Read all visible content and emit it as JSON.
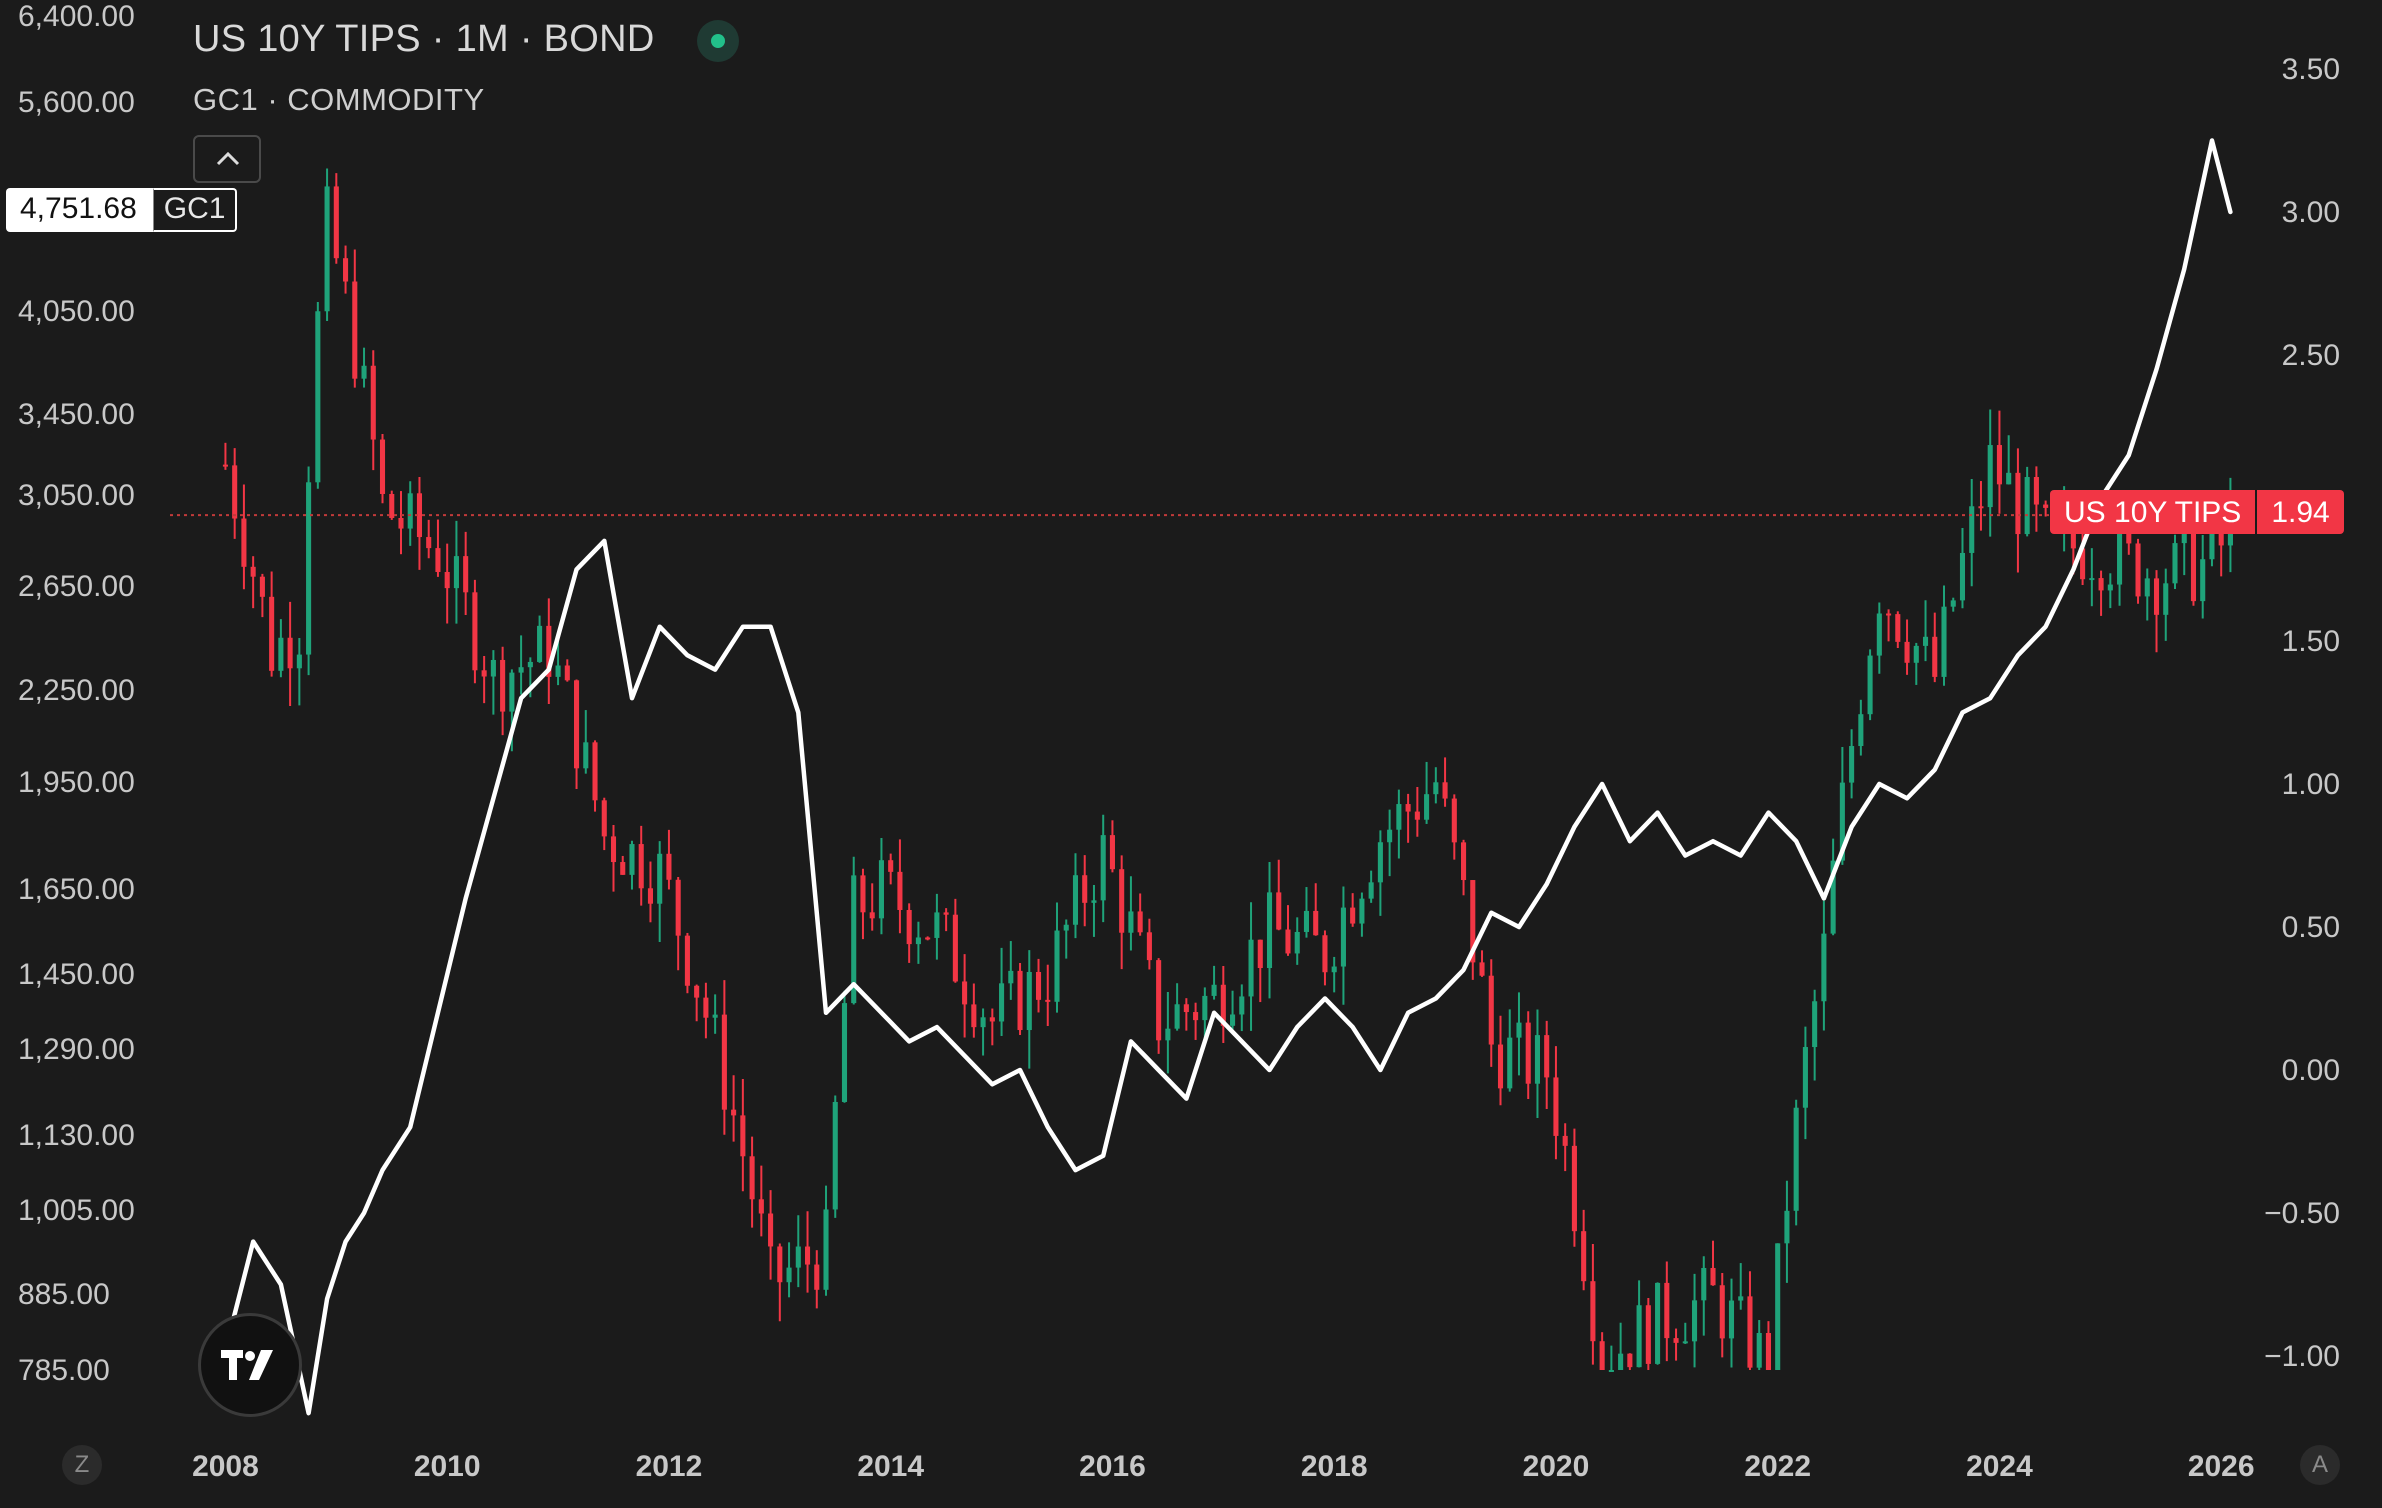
{
  "header": {
    "title": "US 10Y TIPS · 1M · BOND",
    "subtitle": "GC1 · COMMODITY"
  },
  "price_tags": {
    "gc1_value": "4,751.68",
    "gc1_name": "GC1",
    "tips_name": "US 10Y TIPS",
    "tips_value": "1.94"
  },
  "corner_buttons": {
    "left": "Z",
    "right": "A"
  },
  "colors": {
    "background": "#1b1b1b",
    "up_candle": "#1fa37a",
    "down_candle": "#f23645",
    "line": "#ffffff",
    "axis_text": "#c8c8c8"
  },
  "chart_data": {
    "type": "line",
    "left_axis": {
      "series": "GC1",
      "ticks": [
        6400,
        5600,
        4050,
        3450,
        3050,
        2650,
        2250,
        1950,
        1650,
        1450,
        1290,
        1130,
        1005,
        885,
        785
      ],
      "tick_labels": [
        "6,400.00",
        "5,600.00",
        "4,050.00",
        "3,450.00",
        "3,050.00",
        "2,650.00",
        "2,250.00",
        "1,950.00",
        "1,650.00",
        "1,450.00",
        "1,290.00",
        "1,130.00",
        "1,005.00",
        "885.00",
        "785.00"
      ],
      "scale": "nonlinear"
    },
    "right_axis": {
      "series": "US 10Y TIPS",
      "ticks": [
        3.5,
        3.0,
        2.5,
        2.0,
        1.5,
        1.0,
        0.5,
        0.0,
        -0.5,
        -1.0
      ],
      "tick_labels": [
        "3.50",
        "3.00",
        "2.50",
        "",
        "1.50",
        "1.00",
        "0.50",
        "0.00",
        "−0.50",
        "−1.00"
      ],
      "range": [
        -1.25,
        3.5
      ]
    },
    "x_axis": {
      "ticks": [
        "2008",
        "2010",
        "2012",
        "2014",
        "2016",
        "2018",
        "2020",
        "2022",
        "2024",
        "2026"
      ],
      "range": [
        "2007-07",
        "2026-04"
      ]
    },
    "last_value_line": {
      "series": "US 10Y TIPS",
      "value": 1.94,
      "style": "dotted"
    },
    "series": [
      {
        "name": "US 10Y TIPS",
        "type": "line",
        "axis": "right",
        "points": [
          [
            "2008-01",
            -0.98
          ],
          [
            "2008-04",
            -0.6
          ],
          [
            "2008-07",
            -0.75
          ],
          [
            "2008-10",
            -1.2
          ],
          [
            "2008-12",
            -0.8
          ],
          [
            "2009-02",
            -0.6
          ],
          [
            "2009-04",
            -0.5
          ],
          [
            "2009-06",
            -0.35
          ],
          [
            "2009-09",
            -0.2
          ],
          [
            "2009-12",
            0.2
          ],
          [
            "2010-03",
            0.6
          ],
          [
            "2010-06",
            0.95
          ],
          [
            "2010-09",
            1.3
          ],
          [
            "2010-12",
            1.4
          ],
          [
            "2011-03",
            1.75
          ],
          [
            "2011-06",
            1.85
          ],
          [
            "2011-09",
            1.3
          ],
          [
            "2011-12",
            1.55
          ],
          [
            "2012-03",
            1.45
          ],
          [
            "2012-06",
            1.4
          ],
          [
            "2012-09",
            1.55
          ],
          [
            "2012-12",
            1.55
          ],
          [
            "2013-03",
            1.25
          ],
          [
            "2013-06",
            0.2
          ],
          [
            "2013-09",
            0.3
          ],
          [
            "2013-12",
            0.2
          ],
          [
            "2014-03",
            0.1
          ],
          [
            "2014-06",
            0.15
          ],
          [
            "2014-09",
            0.05
          ],
          [
            "2014-12",
            -0.05
          ],
          [
            "2015-03",
            0.0
          ],
          [
            "2015-06",
            -0.2
          ],
          [
            "2015-09",
            -0.35
          ],
          [
            "2015-12",
            -0.3
          ],
          [
            "2016-03",
            0.1
          ],
          [
            "2016-06",
            0.0
          ],
          [
            "2016-09",
            -0.1
          ],
          [
            "2016-12",
            0.2
          ],
          [
            "2017-03",
            0.1
          ],
          [
            "2017-06",
            0.0
          ],
          [
            "2017-09",
            0.15
          ],
          [
            "2017-12",
            0.25
          ],
          [
            "2018-03",
            0.15
          ],
          [
            "2018-06",
            0.0
          ],
          [
            "2018-09",
            0.2
          ],
          [
            "2018-12",
            0.25
          ],
          [
            "2019-03",
            0.35
          ],
          [
            "2019-06",
            0.55
          ],
          [
            "2019-09",
            0.5
          ],
          [
            "2019-12",
            0.65
          ],
          [
            "2020-03",
            0.85
          ],
          [
            "2020-06",
            1.0
          ],
          [
            "2020-09",
            0.8
          ],
          [
            "2020-12",
            0.9
          ],
          [
            "2021-03",
            0.75
          ],
          [
            "2021-06",
            0.8
          ],
          [
            "2021-09",
            0.75
          ],
          [
            "2021-12",
            0.9
          ],
          [
            "2022-03",
            0.8
          ],
          [
            "2022-06",
            0.6
          ],
          [
            "2022-09",
            0.85
          ],
          [
            "2022-12",
            1.0
          ],
          [
            "2023-03",
            0.95
          ],
          [
            "2023-06",
            1.05
          ],
          [
            "2023-09",
            1.25
          ],
          [
            "2023-12",
            1.3
          ],
          [
            "2024-03",
            1.45
          ],
          [
            "2024-06",
            1.55
          ],
          [
            "2024-09",
            1.75
          ],
          [
            "2024-12",
            2.0
          ],
          [
            "2025-03",
            2.15
          ],
          [
            "2025-06",
            2.45
          ],
          [
            "2025-09",
            2.8
          ],
          [
            "2025-12",
            3.25
          ],
          [
            "2026-02",
            3.0
          ]
        ]
      },
      {
        "name": "GC1",
        "type": "candlestick",
        "axis": "left",
        "monthly_close": [
          [
            "2008-01",
            3200
          ],
          [
            "2008-06",
            2400
          ],
          [
            "2008-09",
            2500
          ],
          [
            "2008-12",
            4700
          ],
          [
            "2009-06",
            3000
          ],
          [
            "2009-12",
            2800
          ],
          [
            "2010-06",
            2300
          ],
          [
            "2010-12",
            2400
          ],
          [
            "2011-06",
            1800
          ],
          [
            "2011-12",
            1700
          ],
          [
            "2012-06",
            1300
          ],
          [
            "2012-12",
            900
          ],
          [
            "2013-06",
            950
          ],
          [
            "2013-09",
            1600
          ],
          [
            "2013-12",
            1650
          ],
          [
            "2014-06",
            1550
          ],
          [
            "2014-12",
            1350
          ],
          [
            "2015-06",
            1450
          ],
          [
            "2015-12",
            1750
          ],
          [
            "2016-06",
            1350
          ],
          [
            "2016-12",
            1400
          ],
          [
            "2017-06",
            1550
          ],
          [
            "2017-12",
            1500
          ],
          [
            "2018-06",
            1800
          ],
          [
            "2018-12",
            1950
          ],
          [
            "2019-06",
            1300
          ],
          [
            "2019-12",
            1250
          ],
          [
            "2020-06",
            800
          ],
          [
            "2020-12",
            850
          ],
          [
            "2021-06",
            880
          ],
          [
            "2021-12",
            790
          ],
          [
            "2022-06",
            1500
          ],
          [
            "2022-12",
            2650
          ],
          [
            "2023-06",
            2300
          ],
          [
            "2023-12",
            3200
          ],
          [
            "2024-06",
            2850
          ],
          [
            "2024-12",
            2800
          ],
          [
            "2025-06",
            2700
          ],
          [
            "2025-12",
            2750
          ],
          [
            "2026-02",
            2900
          ]
        ]
      }
    ],
    "grid": false,
    "legend": "top-left"
  }
}
